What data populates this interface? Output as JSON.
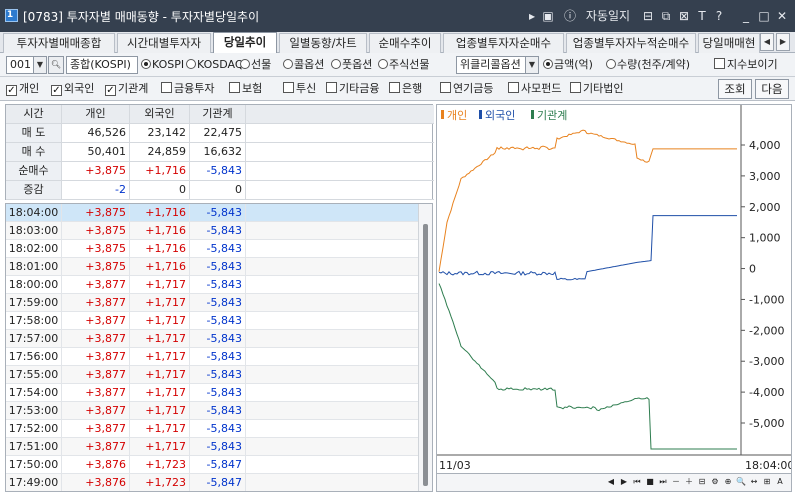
{
  "window": {
    "screen_no": "1",
    "title": "[0783] 투자자별 매매동향 - 투자자별당일추이",
    "tools": [
      "▸",
      "▣",
      "ⓘ",
      "자동일지",
      "⊟",
      "⧉",
      "⊠",
      "T",
      "?",
      "_",
      "□",
      "✕"
    ]
  },
  "tabs": [
    {
      "label": "투자자별매매종합",
      "active": false
    },
    {
      "label": "시간대별투자자",
      "active": false
    },
    {
      "label": "당일추이",
      "active": true
    },
    {
      "label": "일별동향/차트",
      "active": false
    },
    {
      "label": "순매수추이",
      "active": false
    },
    {
      "label": "업종별투자자순매수",
      "active": false
    },
    {
      "label": "업종별투자자누적순매수",
      "active": false
    },
    {
      "label": "당일매매현",
      "active": false
    }
  ],
  "tabnav": {
    "prev": "◀",
    "next": "▶"
  },
  "filters": {
    "code": "001",
    "market": "종합(KOSPI)",
    "market_types": [
      {
        "label": "KOSPI",
        "selected": true
      },
      {
        "label": "KOSDAQ",
        "selected": false
      },
      {
        "label": "선물",
        "selected": false
      },
      {
        "label": "콜옵션",
        "selected": false
      },
      {
        "label": "풋옵션",
        "selected": false
      },
      {
        "label": "주식선물",
        "selected": false
      }
    ],
    "option_select": "위클리콜옵션",
    "units": [
      {
        "label": "금액(억)",
        "selected": true
      },
      {
        "label": "수량(천주/계약)",
        "selected": false
      }
    ],
    "index_view": {
      "label": "지수보이기",
      "checked": false
    }
  },
  "investors": [
    {
      "label": "개인",
      "checked": true
    },
    {
      "label": "외국인",
      "checked": true
    },
    {
      "label": "기관계",
      "checked": true
    },
    {
      "label": "금융투자",
      "checked": false
    },
    {
      "label": "보험",
      "checked": false
    },
    {
      "label": "투신",
      "checked": false
    },
    {
      "label": "기타금융",
      "checked": false
    },
    {
      "label": "은행",
      "checked": false
    },
    {
      "label": "연기금등",
      "checked": false
    },
    {
      "label": "사모펀드",
      "checked": false
    },
    {
      "label": "기타법인",
      "checked": false
    }
  ],
  "buttons": {
    "query": "조회",
    "next": "다음"
  },
  "summary": {
    "headers": [
      "시간",
      "개인",
      "외국인",
      "기관계"
    ],
    "rows": [
      {
        "label": "매 도",
        "values": [
          "46,526",
          "23,142",
          "22,475"
        ],
        "colors": [
          "",
          "",
          ""
        ]
      },
      {
        "label": "매 수",
        "values": [
          "50,401",
          "24,859",
          "16,632"
        ],
        "colors": [
          "",
          "",
          ""
        ]
      },
      {
        "label": "순매수",
        "values": [
          "+3,875",
          "+1,716",
          "-5,843"
        ],
        "colors": [
          "red",
          "red",
          "blue"
        ]
      },
      {
        "label": "증감",
        "values": [
          "-2",
          "0",
          "0"
        ],
        "colors": [
          "blue",
          "",
          ""
        ]
      }
    ]
  },
  "timeline": [
    [
      "18:04:00",
      "+3,875",
      "+1,716",
      "-5,843"
    ],
    [
      "18:03:00",
      "+3,875",
      "+1,716",
      "-5,843"
    ],
    [
      "18:02:00",
      "+3,875",
      "+1,716",
      "-5,843"
    ],
    [
      "18:01:00",
      "+3,875",
      "+1,716",
      "-5,843"
    ],
    [
      "18:00:00",
      "+3,877",
      "+1,717",
      "-5,843"
    ],
    [
      "17:59:00",
      "+3,877",
      "+1,717",
      "-5,843"
    ],
    [
      "17:58:00",
      "+3,877",
      "+1,717",
      "-5,843"
    ],
    [
      "17:57:00",
      "+3,877",
      "+1,717",
      "-5,843"
    ],
    [
      "17:56:00",
      "+3,877",
      "+1,717",
      "-5,843"
    ],
    [
      "17:55:00",
      "+3,877",
      "+1,717",
      "-5,843"
    ],
    [
      "17:54:00",
      "+3,877",
      "+1,717",
      "-5,843"
    ],
    [
      "17:53:00",
      "+3,877",
      "+1,717",
      "-5,843"
    ],
    [
      "17:52:00",
      "+3,877",
      "+1,717",
      "-5,843"
    ],
    [
      "17:51:00",
      "+3,877",
      "+1,717",
      "-5,843"
    ],
    [
      "17:50:00",
      "+3,876",
      "+1,723",
      "-5,847"
    ],
    [
      "17:49:00",
      "+3,876",
      "+1,723",
      "-5,847"
    ]
  ],
  "chart": {
    "legend": [
      {
        "name": "개인",
        "color": "#e8821e"
      },
      {
        "name": "외국인",
        "color": "#1f4fa8"
      },
      {
        "name": "기관계",
        "color": "#2e7d4f"
      }
    ],
    "y_ticks": [
      "4,000",
      "3,000",
      "2,000",
      "1,000",
      "0",
      "-1,000",
      "-2,000",
      "-3,000",
      "-4,000",
      "-5,000"
    ],
    "y_values": [
      4000,
      3000,
      2000,
      1000,
      0,
      -1000,
      -2000,
      -3000,
      -4000,
      -5000
    ],
    "x_start": "11/03",
    "x_end": "18:04:00"
  },
  "chart_controls": [
    "◀",
    "▶",
    "⏮",
    "■",
    "⏭",
    "－",
    "＋",
    "⊟",
    "⚙",
    "⊕",
    "🔍",
    "↔",
    "⊞",
    "A"
  ]
}
